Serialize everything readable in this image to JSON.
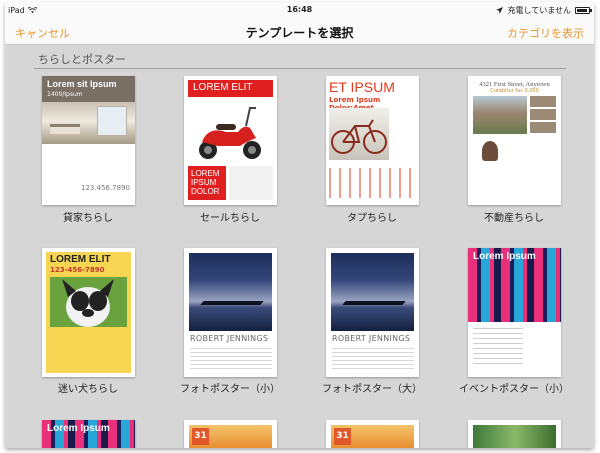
{
  "status_bar": {
    "device": "iPad",
    "time": "16:48",
    "battery_status": "充電していません"
  },
  "nav": {
    "cancel": "キャンセル",
    "title": "テンプレートを選択",
    "categories": "カテゴリを表示"
  },
  "section": {
    "title": "ちらしとポスター"
  },
  "templates": [
    {
      "caption": "貸家ちらし",
      "heading": "Lorem sit Ipsum",
      "sub": "1400/Ipsum",
      "price": "123.456.7890"
    },
    {
      "caption": "セールちらし",
      "heading": "LOREM ELIT",
      "block": "LOREM IPSUM DOLOR"
    },
    {
      "caption": "タプちらし",
      "heading": "ET IPSUM",
      "sub": "Lorem Ipsum Dolor:Amet"
    },
    {
      "caption": "不動産ちらし",
      "heading": "4321 First Street, Anytown",
      "sub": "Curabitur fus 0,000"
    },
    {
      "caption": "迷い犬ちらし",
      "heading": "LOREM ELIT",
      "sub": "123-456-7890"
    },
    {
      "caption": "フォトポスター（小）",
      "name": "ROBERT JENNINGS"
    },
    {
      "caption": "フォトポスター（大）",
      "name": "ROBERT JENNINGS"
    },
    {
      "caption": "イベントポスター（小）",
      "heading": "Lorem Ipsum"
    }
  ],
  "partial_row": [
    {
      "heading": "Lorem Ipsum"
    },
    {
      "date": "31"
    },
    {
      "date": "31"
    },
    {}
  ],
  "colors": {
    "accent": "#e6962b",
    "background": "#d6d6d6"
  }
}
